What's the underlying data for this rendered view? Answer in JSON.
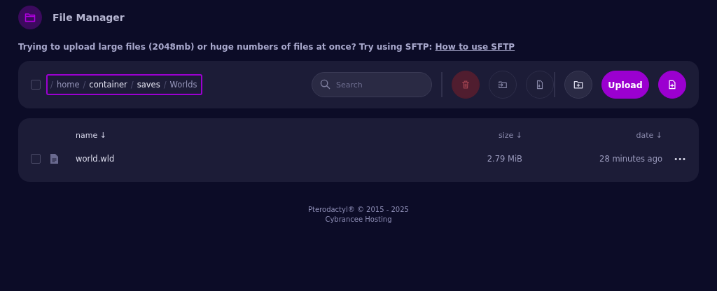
{
  "header": {
    "title": "File Manager"
  },
  "notice": {
    "text": "Trying to upload large files (2048mb) or huge numbers of files at once? Try using SFTP:",
    "link": "How to use SFTP"
  },
  "toolbar": {
    "select_all": {
      "checked": false
    },
    "breadcrumb": {
      "highlighted": true,
      "segments": [
        {
          "separator": "/",
          "label": "home",
          "emphasized": false
        },
        {
          "separator": "/",
          "label": "container",
          "emphasized": true
        },
        {
          "separator": "/",
          "label": "saves",
          "emphasized": true
        },
        {
          "separator": "/",
          "label": "Worlds",
          "emphasized": false
        }
      ]
    },
    "search": {
      "placeholder": "Search"
    },
    "buttons": [
      {
        "kind": "delete",
        "disabled": true
      },
      {
        "kind": "move",
        "disabled": true
      },
      {
        "kind": "archive",
        "disabled": true
      },
      {
        "kind": "new_folder",
        "disabled": false
      },
      {
        "kind": "upload",
        "label": "Upload"
      },
      {
        "kind": "new_file"
      }
    ]
  },
  "table": {
    "columns": [
      {
        "label": "name",
        "sort": "↓",
        "selected": true
      },
      {
        "label": "size",
        "sort": "↓",
        "selected": false
      },
      {
        "label": "date",
        "sort": "↓",
        "selected": false
      }
    ],
    "rows": [
      {
        "checked": false,
        "name": "world.wld",
        "size": "2.79 MiB",
        "date": "28 minutes ago",
        "menu": "•••"
      }
    ]
  },
  "footer": {
    "lines": [
      "Pterodactyl® © 2015 - 2025",
      "Cybrancee Hosting"
    ]
  }
}
